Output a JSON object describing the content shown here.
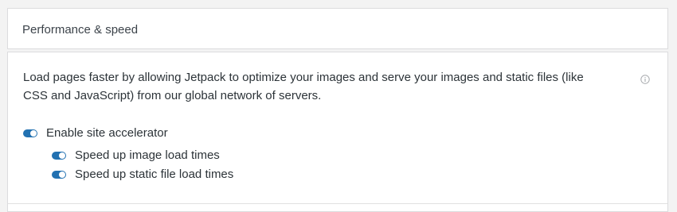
{
  "header": {
    "title": "Performance & speed"
  },
  "main": {
    "description": "Load pages faster by allowing Jetpack to optimize your images and serve your images and static files (like CSS and JavaScript) from our global network of servers.",
    "info_icon": "info-icon",
    "toggles": [
      {
        "label": "Enable site accelerator",
        "enabled": true
      },
      {
        "label": "Speed up image load times",
        "enabled": true
      },
      {
        "label": "Speed up static file load times",
        "enabled": true
      }
    ]
  },
  "colors": {
    "toggle_on": "#2271b1",
    "border": "#dcdcde",
    "background": "#f3f3f3"
  }
}
